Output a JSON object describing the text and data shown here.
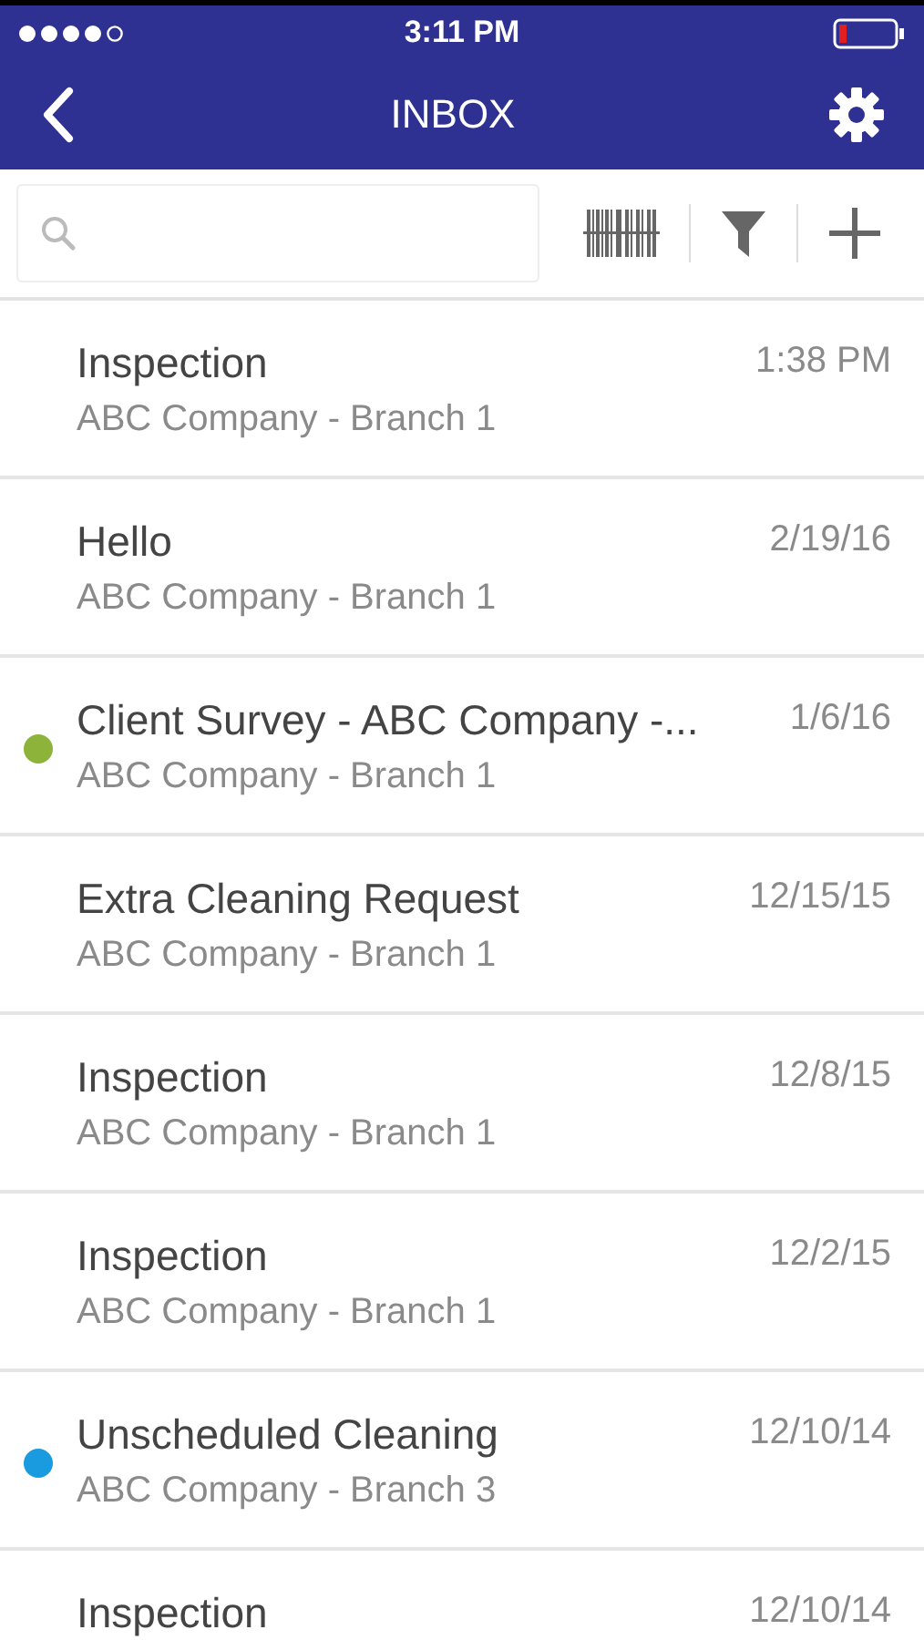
{
  "status_bar": {
    "time": "3:11 PM"
  },
  "header": {
    "title": "INBOX"
  },
  "messages": [
    {
      "title": "Inspection",
      "subtitle": "ABC Company - Branch 1",
      "date": "1:38 PM"
    },
    {
      "title": "Hello",
      "subtitle": "ABC Company - Branch 1",
      "date": "2/19/16"
    },
    {
      "title": "Client Survey - ABC Company -...",
      "subtitle": "ABC Company - Branch 1",
      "date": "1/6/16",
      "color": "#8db33a"
    },
    {
      "title": "Extra Cleaning Request",
      "subtitle": "ABC Company - Branch 1",
      "date": "12/15/15"
    },
    {
      "title": "Inspection",
      "subtitle": "ABC Company - Branch 1",
      "date": "12/8/15"
    },
    {
      "title": "Inspection",
      "subtitle": "ABC Company - Branch 1",
      "date": "12/2/15"
    },
    {
      "title": "Unscheduled Cleaning",
      "subtitle": "ABC Company - Branch 3",
      "date": "12/10/14",
      "color": "#1a9be0"
    },
    {
      "title": "Inspection",
      "date": "12/10/14"
    }
  ]
}
